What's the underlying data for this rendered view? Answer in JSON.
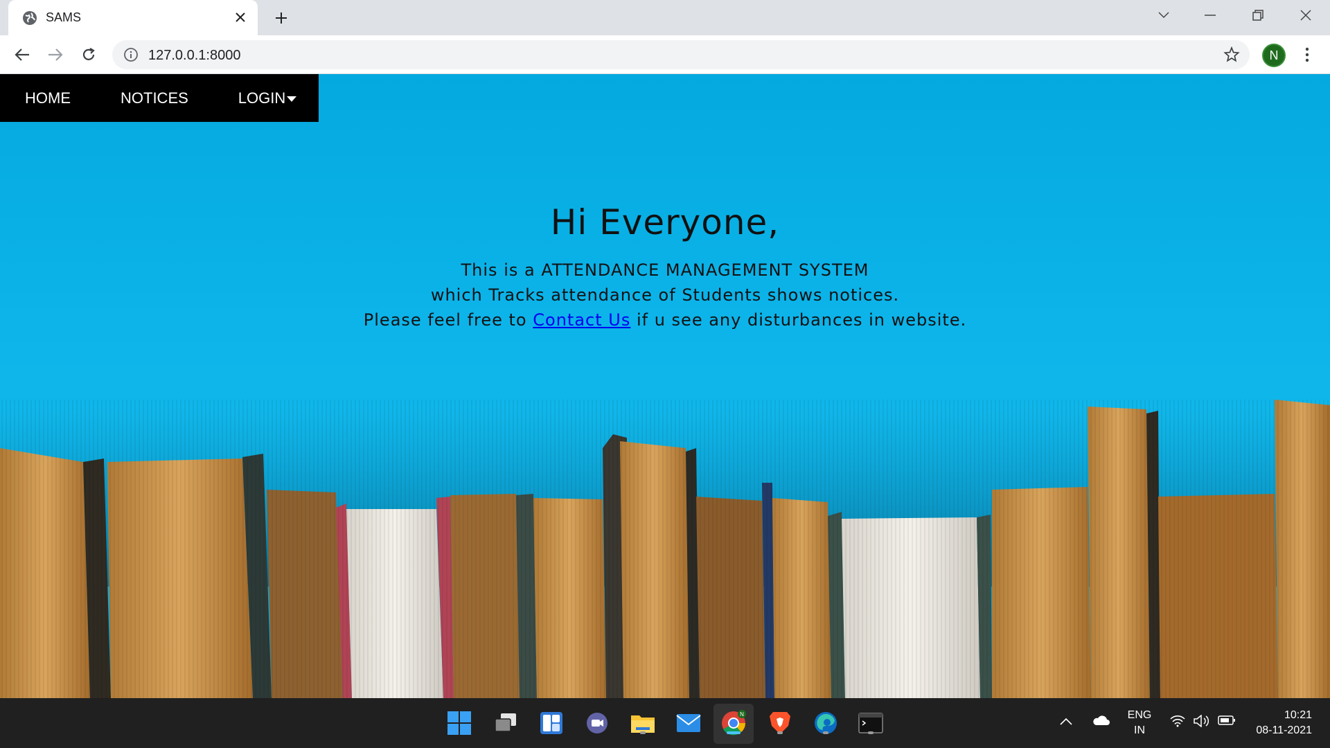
{
  "browser": {
    "tab_title": "SAMS",
    "url": "127.0.0.1:8000",
    "profile_initial": "N",
    "icons": [
      "globe-icon",
      "close-icon",
      "plus-icon",
      "chevron-down-icon",
      "minimize-icon",
      "restore-icon",
      "window-close-icon",
      "back-icon",
      "forward-icon",
      "reload-icon",
      "info-icon",
      "star-icon",
      "kebab-menu-icon"
    ]
  },
  "site": {
    "nav": {
      "home": "HOME",
      "notices": "NOTICES",
      "login": "LOGIN"
    },
    "hero": {
      "heading": "Hi Everyone,",
      "line1": "This is a ATTENDANCE MANAGEMENT SYSTEM",
      "line2": "which Tracks attendance of Students shows notices.",
      "line3_before": "Please feel free to ",
      "link": "Contact Us",
      "line3_after": " if u see any disturbances in website."
    },
    "colors": {
      "background": "#00b2ea",
      "nav_bg": "#000000",
      "link": "#0000ee"
    }
  },
  "taskbar": {
    "apps": [
      "start",
      "task-view",
      "widgets",
      "chat",
      "file-explorer",
      "mail",
      "chrome",
      "brave",
      "edge",
      "terminal"
    ],
    "tray": {
      "lang_top": "ENG",
      "lang_bottom": "IN",
      "time": "10:21",
      "date": "08-11-2021"
    }
  }
}
